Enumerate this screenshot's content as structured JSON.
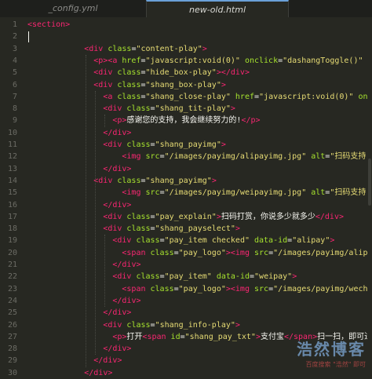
{
  "tabs": [
    {
      "label": "_config.yml",
      "active": false
    },
    {
      "label": "new-old.html",
      "active": true
    }
  ],
  "lines": [
    {
      "n": "1",
      "indent": 0,
      "tokens": [
        [
          "tag",
          "<section>"
        ]
      ]
    },
    {
      "n": "2",
      "indent": 0,
      "tokens": []
    },
    {
      "n": "3",
      "indent": 6,
      "tokens": [
        [
          "tag",
          "<div "
        ],
        [
          "attr",
          "class"
        ],
        [
          "punc",
          "="
        ],
        [
          "str",
          "\"content-play\""
        ],
        [
          "tag",
          ">"
        ]
      ]
    },
    {
      "n": "4",
      "indent": 7,
      "tokens": [
        [
          "tag",
          "<p><a "
        ],
        [
          "attr",
          "href"
        ],
        [
          "punc",
          "="
        ],
        [
          "str",
          "\"javascript:void(0)\" "
        ],
        [
          "attr",
          "onclick"
        ],
        [
          "punc",
          "="
        ],
        [
          "str",
          "\"dashangToggle()\" "
        ],
        [
          "attr",
          "cla"
        ]
      ]
    },
    {
      "n": "5",
      "indent": 7,
      "tokens": [
        [
          "tag",
          "<div "
        ],
        [
          "attr",
          "class"
        ],
        [
          "punc",
          "="
        ],
        [
          "str",
          "\"hide_box-play\""
        ],
        [
          "tag",
          "></div>"
        ]
      ]
    },
    {
      "n": "6",
      "indent": 7,
      "tokens": [
        [
          "tag",
          "<div "
        ],
        [
          "attr",
          "class"
        ],
        [
          "punc",
          "="
        ],
        [
          "str",
          "\"shang_box-play\""
        ],
        [
          "tag",
          ">"
        ]
      ]
    },
    {
      "n": "7",
      "indent": 8,
      "tokens": [
        [
          "tag",
          "<a "
        ],
        [
          "attr",
          "class"
        ],
        [
          "punc",
          "="
        ],
        [
          "str",
          "\"shang_close-play\" "
        ],
        [
          "attr",
          "href"
        ],
        [
          "punc",
          "="
        ],
        [
          "str",
          "\"javascript:void(0)\" "
        ],
        [
          "attr",
          "oncli"
        ]
      ]
    },
    {
      "n": "8",
      "indent": 8,
      "tokens": [
        [
          "tag",
          "<div "
        ],
        [
          "attr",
          "class"
        ],
        [
          "punc",
          "="
        ],
        [
          "str",
          "\"shang_tit-play\""
        ],
        [
          "tag",
          ">"
        ]
      ]
    },
    {
      "n": "9",
      "indent": 9,
      "tokens": [
        [
          "tag",
          "<p>"
        ],
        [
          "txt",
          "感谢您的支持，我会继续努力的!"
        ],
        [
          "tag",
          "</p>"
        ]
      ]
    },
    {
      "n": "10",
      "indent": 8,
      "tokens": [
        [
          "tag",
          "</div>"
        ]
      ]
    },
    {
      "n": "11",
      "indent": 8,
      "tokens": [
        [
          "tag",
          "<div "
        ],
        [
          "attr",
          "class"
        ],
        [
          "punc",
          "="
        ],
        [
          "str",
          "\"shang_payimg\""
        ],
        [
          "tag",
          ">"
        ]
      ]
    },
    {
      "n": "12",
      "indent": 10,
      "tokens": [
        [
          "tag",
          "<img "
        ],
        [
          "attr",
          "src"
        ],
        [
          "punc",
          "="
        ],
        [
          "str",
          "\"/images/payimg/alipayimg.jpg\" "
        ],
        [
          "attr",
          "alt"
        ],
        [
          "punc",
          "="
        ],
        [
          "str",
          "\"扫码支持\" "
        ],
        [
          "attr",
          "t"
        ]
      ]
    },
    {
      "n": "13",
      "indent": 8,
      "tokens": [
        [
          "tag",
          "</div>"
        ]
      ]
    },
    {
      "n": "14",
      "indent": 7,
      "tokens": [
        [
          "tag",
          "<div "
        ],
        [
          "attr",
          "class"
        ],
        [
          "punc",
          "="
        ],
        [
          "str",
          "\"shang_payimg\""
        ],
        [
          "tag",
          ">"
        ]
      ]
    },
    {
      "n": "15",
      "indent": 10,
      "tokens": [
        [
          "tag",
          "<img "
        ],
        [
          "attr",
          "src"
        ],
        [
          "punc",
          "="
        ],
        [
          "str",
          "\"/images/payimg/weipayimg.jpg\" "
        ],
        [
          "attr",
          "alt"
        ],
        [
          "punc",
          "="
        ],
        [
          "str",
          "\"扫码支持\" "
        ],
        [
          "attr",
          "t"
        ]
      ]
    },
    {
      "n": "16",
      "indent": 8,
      "tokens": [
        [
          "tag",
          "</div>"
        ]
      ]
    },
    {
      "n": "17",
      "indent": 8,
      "tokens": [
        [
          "tag",
          "<div "
        ],
        [
          "attr",
          "class"
        ],
        [
          "punc",
          "="
        ],
        [
          "str",
          "\"pay_explain\""
        ],
        [
          "tag",
          ">"
        ],
        [
          "txt",
          "扫码打赏，你说多少就多少"
        ],
        [
          "tag",
          "</div>"
        ]
      ]
    },
    {
      "n": "18",
      "indent": 8,
      "tokens": [
        [
          "tag",
          "<div "
        ],
        [
          "attr",
          "class"
        ],
        [
          "punc",
          "="
        ],
        [
          "str",
          "\"shang_payselect\""
        ],
        [
          "tag",
          ">"
        ]
      ]
    },
    {
      "n": "19",
      "indent": 9,
      "tokens": [
        [
          "tag",
          "<div "
        ],
        [
          "attr",
          "class"
        ],
        [
          "punc",
          "="
        ],
        [
          "str",
          "\"pay_item checked\" "
        ],
        [
          "attr",
          "data-id"
        ],
        [
          "punc",
          "="
        ],
        [
          "str",
          "\"alipay\""
        ],
        [
          "tag",
          ">"
        ]
      ]
    },
    {
      "n": "20",
      "indent": 10,
      "tokens": [
        [
          "tag",
          "<span "
        ],
        [
          "attr",
          "class"
        ],
        [
          "punc",
          "="
        ],
        [
          "str",
          "\"pay_logo\""
        ],
        [
          "tag",
          "><img "
        ],
        [
          "attr",
          "src"
        ],
        [
          "punc",
          "="
        ],
        [
          "str",
          "\"/images/payimg/alipay."
        ]
      ]
    },
    {
      "n": "21",
      "indent": 9,
      "tokens": [
        [
          "tag",
          "</div>"
        ]
      ]
    },
    {
      "n": "22",
      "indent": 9,
      "tokens": [
        [
          "tag",
          "<div "
        ],
        [
          "attr",
          "class"
        ],
        [
          "punc",
          "="
        ],
        [
          "str",
          "\"pay_item\" "
        ],
        [
          "attr",
          "data-id"
        ],
        [
          "punc",
          "="
        ],
        [
          "str",
          "\"weipay\""
        ],
        [
          "tag",
          ">"
        ]
      ]
    },
    {
      "n": "23",
      "indent": 10,
      "tokens": [
        [
          "tag",
          "<span "
        ],
        [
          "attr",
          "class"
        ],
        [
          "punc",
          "="
        ],
        [
          "str",
          "\"pay_logo\""
        ],
        [
          "tag",
          "><img "
        ],
        [
          "attr",
          "src"
        ],
        [
          "punc",
          "="
        ],
        [
          "str",
          "\"/images/payimg/wechat."
        ]
      ]
    },
    {
      "n": "24",
      "indent": 9,
      "tokens": [
        [
          "tag",
          "</div>"
        ]
      ]
    },
    {
      "n": "25",
      "indent": 8,
      "tokens": [
        [
          "tag",
          "</div>"
        ]
      ]
    },
    {
      "n": "26",
      "indent": 8,
      "tokens": [
        [
          "tag",
          "<div "
        ],
        [
          "attr",
          "class"
        ],
        [
          "punc",
          "="
        ],
        [
          "str",
          "\"shang_info-play\""
        ],
        [
          "tag",
          ">"
        ]
      ]
    },
    {
      "n": "27",
      "indent": 9,
      "tokens": [
        [
          "tag",
          "<p>"
        ],
        [
          "txt",
          "打开"
        ],
        [
          "tag",
          "<span "
        ],
        [
          "attr",
          "id"
        ],
        [
          "punc",
          "="
        ],
        [
          "str",
          "\"shang_pay_txt\""
        ],
        [
          "tag",
          ">"
        ],
        [
          "txt",
          "支付宝"
        ],
        [
          "tag",
          "</span>"
        ],
        [
          "txt",
          "扫一扫，即可进行"
        ]
      ]
    },
    {
      "n": "28",
      "indent": 8,
      "tokens": [
        [
          "tag",
          "</div>"
        ]
      ]
    },
    {
      "n": "29",
      "indent": 7,
      "tokens": [
        [
          "tag",
          "</div>"
        ]
      ]
    },
    {
      "n": "30",
      "indent": 6,
      "tokens": [
        [
          "tag",
          "</div>"
        ]
      ]
    }
  ],
  "watermark": {
    "main": "浩然博客",
    "sub": "百度搜索 \"浩然\" 即可"
  },
  "colors": {
    "bg": "#272822",
    "tag": "#f92672",
    "attr": "#a6e22e",
    "str": "#e6db74",
    "text": "#f8f8f2",
    "lineNumber": "#6c6c65"
  }
}
